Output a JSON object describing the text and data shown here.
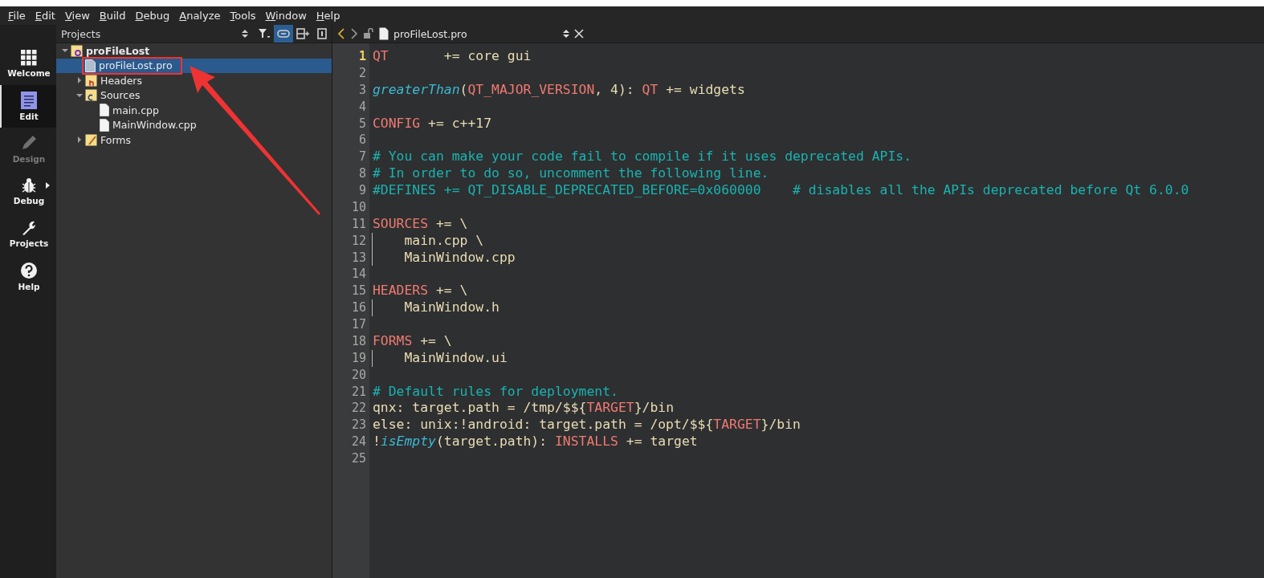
{
  "menu_bar": [
    "File",
    "Edit",
    "View",
    "Build",
    "Debug",
    "Analyze",
    "Tools",
    "Window",
    "Help"
  ],
  "mode_bar": [
    {
      "label": "Welcome",
      "kind": "welcome",
      "selected": false,
      "disabled": false
    },
    {
      "label": "Edit",
      "kind": "edit",
      "selected": true,
      "disabled": false
    },
    {
      "label": "Design",
      "kind": "design",
      "selected": false,
      "disabled": true
    },
    {
      "label": "Debug",
      "kind": "debug",
      "selected": false,
      "disabled": false
    },
    {
      "label": "Projects",
      "kind": "projects",
      "selected": false,
      "disabled": false
    },
    {
      "label": "Help",
      "kind": "help",
      "selected": false,
      "disabled": false
    }
  ],
  "projects_panel": {
    "title": "Projects",
    "sync_selected": true,
    "tree": [
      {
        "label": "proFileLost",
        "kind": "project",
        "expanded": true,
        "selected": false,
        "children": [
          {
            "label": "proFileLost.pro",
            "kind": "pro",
            "selected": true,
            "highlighted": true
          },
          {
            "label": "Headers",
            "kind": "headers",
            "expanded": false,
            "selected": false
          },
          {
            "label": "Sources",
            "kind": "sources",
            "expanded": true,
            "selected": false,
            "children": [
              {
                "label": "main.cpp",
                "kind": "cpp",
                "selected": false
              },
              {
                "label": "MainWindow.cpp",
                "kind": "cpp",
                "selected": false
              }
            ]
          },
          {
            "label": "Forms",
            "kind": "forms",
            "expanded": false,
            "selected": false
          }
        ]
      }
    ]
  },
  "editor": {
    "file_name": "proFileLost.pro",
    "lines": [
      {
        "number": "1",
        "selected": true,
        "guide": false,
        "tokens": [
          {
            "t": "QT",
            "kind": "keyword"
          },
          {
            "t": "       += core gui",
            "kind": "plain"
          }
        ]
      },
      {
        "number": "2",
        "selected": false,
        "guide": false
      },
      {
        "number": "3",
        "selected": false,
        "guide": false,
        "tokens": [
          {
            "t": "greaterThan",
            "kind": "function"
          },
          {
            "t": "(",
            "kind": "plain"
          },
          {
            "t": "QT_MAJOR_VERSION",
            "kind": "keyword"
          },
          {
            "t": ", 4): ",
            "kind": "plain"
          },
          {
            "t": "QT",
            "kind": "keyword"
          },
          {
            "t": " += widgets",
            "kind": "plain"
          }
        ]
      },
      {
        "number": "4",
        "selected": false,
        "guide": false
      },
      {
        "number": "5",
        "selected": false,
        "guide": false,
        "tokens": [
          {
            "t": "CONFIG",
            "kind": "keyword"
          },
          {
            "t": " += c++17",
            "kind": "plain"
          }
        ]
      },
      {
        "number": "6",
        "selected": false,
        "guide": false
      },
      {
        "number": "7",
        "selected": false,
        "guide": false,
        "tokens": [
          {
            "t": "# You can make your code fail to compile if it uses deprecated APIs.",
            "kind": "comment"
          }
        ]
      },
      {
        "number": "8",
        "selected": false,
        "guide": false,
        "tokens": [
          {
            "t": "# In order to do so, uncomment the following line.",
            "kind": "comment"
          }
        ]
      },
      {
        "number": "9",
        "selected": false,
        "guide": false,
        "tokens": [
          {
            "t": "#DEFINES += QT_DISABLE_DEPRECATED_BEFORE=0x060000    # disables all the APIs deprecated before Qt 6.0.0",
            "kind": "comment"
          }
        ]
      },
      {
        "number": "10",
        "selected": false,
        "guide": false
      },
      {
        "number": "11",
        "selected": false,
        "guide": false,
        "tokens": [
          {
            "t": "SOURCES",
            "kind": "keyword"
          },
          {
            "t": " += \\",
            "kind": "plain"
          }
        ]
      },
      {
        "number": "12",
        "selected": false,
        "guide": true,
        "tokens": [
          {
            "t": "    main.cpp \\",
            "kind": "plain"
          }
        ]
      },
      {
        "number": "13",
        "selected": false,
        "guide": true,
        "tokens": [
          {
            "t": "    MainWindow.cpp",
            "kind": "plain"
          }
        ]
      },
      {
        "number": "14",
        "selected": false,
        "guide": false
      },
      {
        "number": "15",
        "selected": false,
        "guide": false,
        "tokens": [
          {
            "t": "HEADERS",
            "kind": "keyword"
          },
          {
            "t": " += \\",
            "kind": "plain"
          }
        ]
      },
      {
        "number": "16",
        "selected": false,
        "guide": true,
        "tokens": [
          {
            "t": "    MainWindow.h",
            "kind": "plain"
          }
        ]
      },
      {
        "number": "17",
        "selected": false,
        "guide": false
      },
      {
        "number": "18",
        "selected": false,
        "guide": false,
        "tokens": [
          {
            "t": "FORMS",
            "kind": "keyword"
          },
          {
            "t": " += \\",
            "kind": "plain"
          }
        ]
      },
      {
        "number": "19",
        "selected": false,
        "guide": true,
        "tokens": [
          {
            "t": "    MainWindow.ui",
            "kind": "plain"
          }
        ]
      },
      {
        "number": "20",
        "selected": false,
        "guide": false
      },
      {
        "number": "21",
        "selected": false,
        "guide": false,
        "tokens": [
          {
            "t": "# Default rules for deployment.",
            "kind": "comment"
          }
        ]
      },
      {
        "number": "22",
        "selected": false,
        "guide": false,
        "tokens": [
          {
            "t": "qnx: target.path = /tmp/$${",
            "kind": "plain"
          },
          {
            "t": "TARGET",
            "kind": "keyword"
          },
          {
            "t": "}/bin",
            "kind": "plain"
          }
        ]
      },
      {
        "number": "23",
        "selected": false,
        "guide": false,
        "tokens": [
          {
            "t": "else: unix:!android: target.path = /opt/$${",
            "kind": "plain"
          },
          {
            "t": "TARGET",
            "kind": "keyword"
          },
          {
            "t": "}/bin",
            "kind": "plain"
          }
        ]
      },
      {
        "number": "24",
        "selected": false,
        "guide": false,
        "tokens": [
          {
            "t": "!",
            "kind": "plain"
          },
          {
            "t": "isEmpty",
            "kind": "function"
          },
          {
            "t": "(target.path): ",
            "kind": "plain"
          },
          {
            "t": "INSTALLS",
            "kind": "keyword"
          },
          {
            "t": " += target",
            "kind": "plain"
          }
        ]
      },
      {
        "number": "25",
        "selected": false,
        "guide": false
      }
    ]
  }
}
